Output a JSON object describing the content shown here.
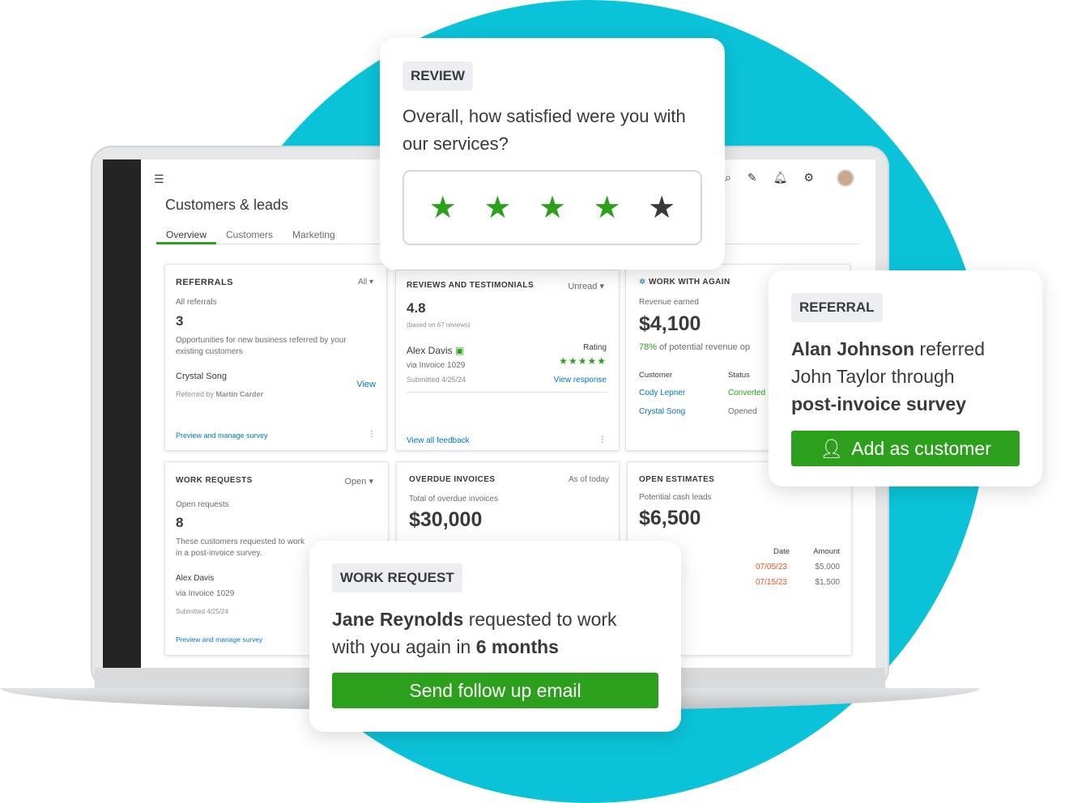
{
  "colors": {
    "teal": "#0bc3d9",
    "green": "#2ca01c",
    "link": "#0077c5",
    "orange": "#f4511e"
  },
  "app": {
    "title": "Customers & leads",
    "tabs": [
      "Overview",
      "Customers",
      "Marketing"
    ],
    "active_tab": "Overview",
    "icons": [
      "menu-icon",
      "search-icon",
      "edit-icon",
      "bell-icon",
      "gear-icon",
      "avatar"
    ]
  },
  "referrals": {
    "title": "REFERRALS",
    "filter": "All",
    "label": "All referrals",
    "count": "3",
    "desc": "Opportunities for new business referred by your existing customers",
    "name": "Crystal Song",
    "referred_prefix": "Referred by ",
    "referrer": "Martin Carder",
    "view": "View",
    "footer": "Preview and manage survey"
  },
  "reviews": {
    "title": "REVIEWS AND TESTIMONIALS",
    "filter": "Unread",
    "score": "4.8",
    "based": "(based on 67 reviews)",
    "name": "Alex Davis",
    "via": "via Invoice 1029",
    "submitted": "Submitted 4/25/24",
    "rating_label": "Rating",
    "rating": 5,
    "view_response": "View response",
    "footer": "View all feedback"
  },
  "work_again": {
    "title": "WORK WITH AGAIN",
    "label": "Revenue earned",
    "amount": "$4,100",
    "pct": "78%",
    "pct_text": " of potential revenue op",
    "col_customer": "Customer",
    "col_status": "Status",
    "rows": [
      {
        "customer": "Cody Lepner",
        "status": "Converted"
      },
      {
        "customer": "Crystal Song",
        "status": "Opened"
      }
    ]
  },
  "work_requests": {
    "title": "WORK REQUESTS",
    "filter": "Open",
    "label": "Open requests",
    "count": "8",
    "desc1": "These customers requested to work ",
    "desc2": "in a post-invoice survey.",
    "name": "Alex Davis",
    "via": "via Invoice 1029",
    "submitted": "Submitted 4/25/24",
    "footer": "Preview and manage survey"
  },
  "overdue": {
    "title": "OVERDUE INVOICES",
    "asof": "As of today",
    "label": "Total of overdue invoices",
    "amount": "$30,000"
  },
  "estimates": {
    "title": "OPEN ESTIMATES",
    "label": "Potential cash leads",
    "amount": "$6,500",
    "col_date": "Date",
    "col_amount": "Amount",
    "rows": [
      {
        "date": "07/05/23",
        "amount": "$5,000"
      },
      {
        "date": "07/15/23",
        "amount": "$1,500"
      }
    ]
  },
  "review_popup": {
    "tag": "REVIEW",
    "question": "Overall, how satisfied were you with our services?",
    "stars_filled": 4,
    "stars_total": 5
  },
  "referral_popup": {
    "tag": "REFERRAL",
    "referrer": "Alan Johnson",
    "mid": " referred John Taylor through ",
    "source": "post-invoice survey",
    "button": "Add as customer"
  },
  "work_popup": {
    "tag": "WORK REQUEST",
    "name": "Jane Reynolds",
    "mid": " requested to work with you again in ",
    "period": "6 months",
    "button": "Send follow up email"
  }
}
